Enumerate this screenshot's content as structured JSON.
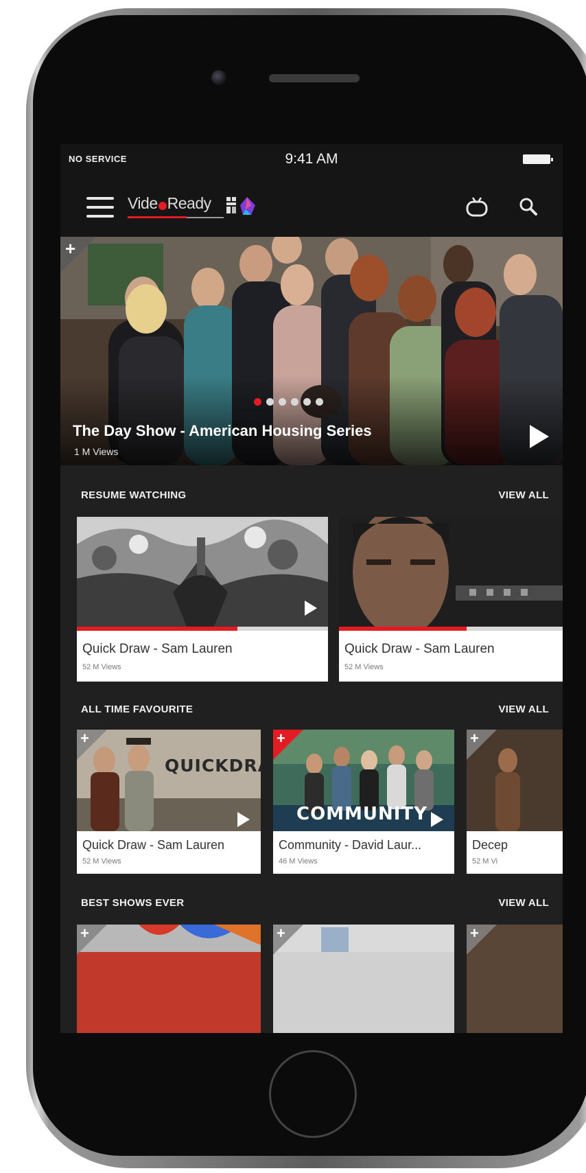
{
  "status_bar": {
    "service": "NO SERVICE",
    "time": "9:41 AM"
  },
  "app_bar": {
    "logo_text_left": "Vide",
    "logo_text_right": "Ready"
  },
  "hero": {
    "title": "The Day Show - American Housing Series",
    "views": "1 M  Views",
    "add_label": "+",
    "carousel_pages": 6,
    "carousel_active_index": 0
  },
  "sections": {
    "resume_watching": {
      "title": "RESUME WATCHING",
      "view_all": "VIEW ALL",
      "items": [
        {
          "title": "Quick Draw - Sam Lauren",
          "views": "52 M Views",
          "progress": 0.64
        },
        {
          "title": "Quick Draw - Sam Lauren",
          "views": "52 M Views",
          "progress": 0.57
        }
      ]
    },
    "all_time_favourite": {
      "title": "ALL TIME FAVOURITE",
      "view_all": "VIEW ALL",
      "items": [
        {
          "title": "Quick Draw - Sam Lauren",
          "views": "52 M Views",
          "thumb_text": "QUICKDRAW"
        },
        {
          "title": "Community - David Laur...",
          "views": "46 M Views",
          "thumb_text": "COMMUNITY"
        },
        {
          "title": "Decep",
          "views": "52 M Vi"
        }
      ]
    },
    "best_shows_ever": {
      "title": "BEST SHOWS EVER",
      "view_all": "VIEW ALL"
    }
  },
  "colors": {
    "accent": "#e31b23",
    "background": "#202020",
    "bar": "#151515"
  }
}
